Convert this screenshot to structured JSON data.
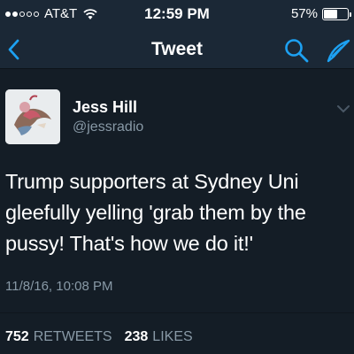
{
  "status_bar": {
    "signal_bars_filled": 2,
    "signal_bars_total": 5,
    "carrier": "AT&T",
    "time": "12:59 PM",
    "battery_percent": "57%",
    "battery_level": 0.57
  },
  "nav": {
    "title": "Tweet",
    "back_icon": "chevron-left-icon",
    "search_icon": "search-icon",
    "compose_icon": "compose-icon"
  },
  "tweet": {
    "author_name": "Jess Hill",
    "author_handle": "@jessradio",
    "text": "Trump supporters at Sydney Uni gleefully yelling 'grab them by the pussy! That's how we do it!'",
    "timestamp": "11/8/16, 10:08 PM",
    "retweets_count": "752",
    "retweets_label": "RETWEETS",
    "likes_count": "238",
    "likes_label": "LIKES"
  },
  "colors": {
    "background": "#141d26",
    "bar": "#1b2836",
    "accent": "#1da1f2",
    "secondary_text": "#8899a6"
  }
}
